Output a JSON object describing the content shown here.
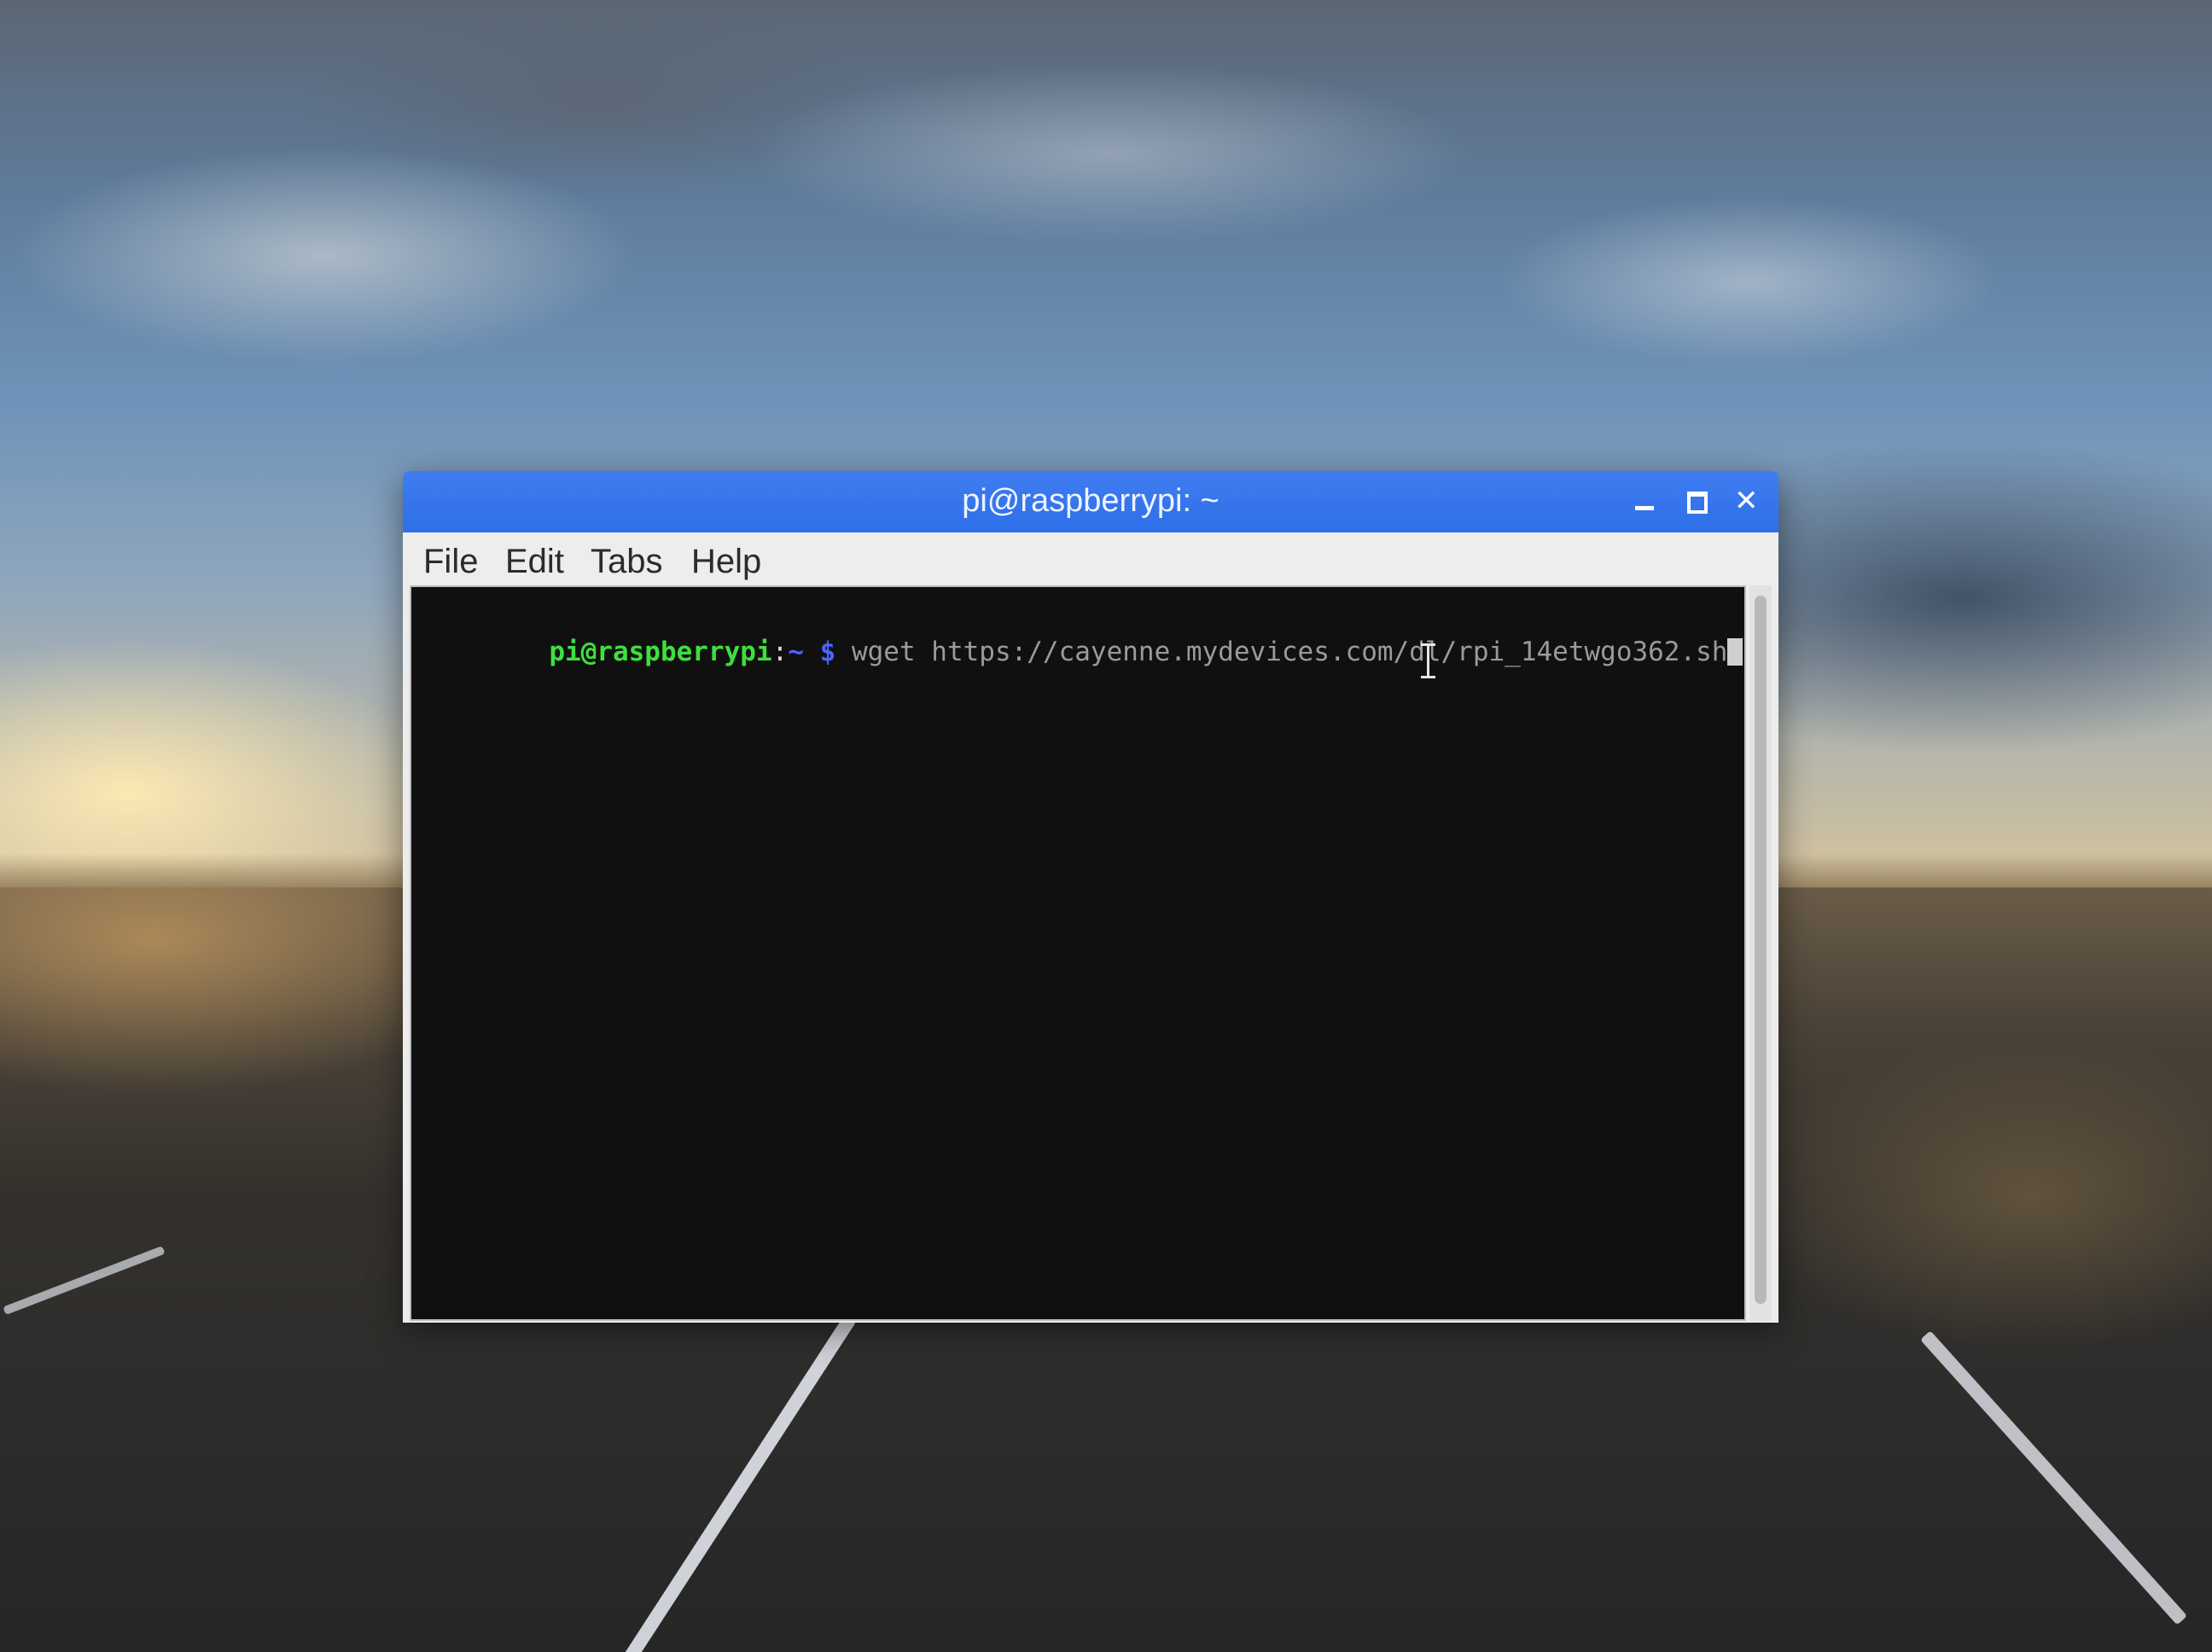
{
  "window": {
    "title": "pi@raspberrypi: ~",
    "controls": {
      "minimize": "minimize",
      "maximize": "maximize",
      "close": "close"
    }
  },
  "menu": {
    "items": [
      {
        "label": "File"
      },
      {
        "label": "Edit"
      },
      {
        "label": "Tabs"
      },
      {
        "label": "Help"
      }
    ]
  },
  "terminal": {
    "prompt_user": "pi@raspberrypi",
    "prompt_colon": ":",
    "prompt_path": "~",
    "prompt_symbol": "$",
    "command": "wget https://cayenne.mydevices.com/dl/rpi_14etwgo362.sh"
  },
  "colors": {
    "titlebar": "#2e6fe8",
    "prompt_user": "#3ee03e",
    "prompt_path": "#4b63ff",
    "terminal_background": "#101010"
  },
  "icons": {
    "minimize": "minimize-icon",
    "maximize": "maximize-icon",
    "close": "close-icon",
    "pointer": "text-cursor-icon"
  }
}
